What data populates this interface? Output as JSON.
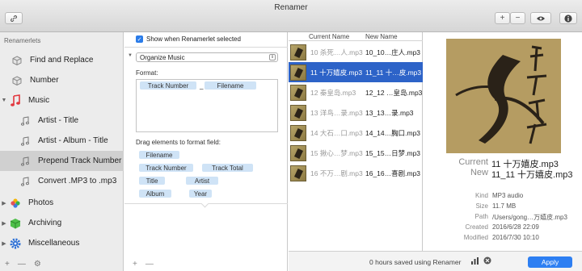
{
  "window": {
    "title": "Renamer"
  },
  "toolbar": {
    "plus": "+",
    "minus": "−"
  },
  "sidebar": {
    "header": "Renamerlets",
    "items": [
      {
        "label": "Find and Replace",
        "icon": "cube-icon"
      },
      {
        "label": "Number",
        "icon": "cube-icon"
      },
      {
        "label": "Music",
        "icon": "music-note-icon"
      },
      {
        "label": "Artist - Title",
        "icon": "music-note-icon"
      },
      {
        "label": "Artist - Album - Title",
        "icon": "music-note-icon"
      },
      {
        "label": "Prepend Track Number",
        "icon": "music-note-icon"
      },
      {
        "label": "Convert .MP3 to .mp3",
        "icon": "music-note-icon"
      },
      {
        "label": "Photos",
        "icon": "photos-icon"
      },
      {
        "label": "Archiving",
        "icon": "archive-icon"
      },
      {
        "label": "Miscellaneous",
        "icon": "gear-icon"
      }
    ],
    "footer": {
      "add": "+",
      "remove": "—",
      "gear": "⚙"
    }
  },
  "editor": {
    "show_when_selected": "Show when Renamerlet selected",
    "select_value": "Organize Music",
    "format_label": "Format:",
    "format_chips": [
      "Track Number",
      "_",
      "Filename"
    ],
    "drag_label": "Drag elements to format field:",
    "elements": [
      "Filename",
      "Track Number",
      "Track Total",
      "Title",
      "Artist",
      "Album",
      "Year"
    ],
    "footer": {
      "add": "+",
      "remove": "—"
    }
  },
  "file_list": {
    "columns": [
      "Current Name",
      "New Name"
    ],
    "rows": [
      {
        "current": "10 杀死…人.mp3",
        "new": "10_10…庄人.mp3"
      },
      {
        "current": "11 十万嬉皮.mp3",
        "new": "11_11 十…皮.mp3"
      },
      {
        "current": "12 秦皇岛.mp3",
        "new": "12_12 …皇岛.mp3"
      },
      {
        "current": "13 洋鸟…录.mp3",
        "new": "13_13…录.mp3"
      },
      {
        "current": "14 大石…口.mp3",
        "new": "14_14…胸口.mp3"
      },
      {
        "current": "15 揪心…梦.mp3",
        "new": "15_15…日梦.mp3"
      },
      {
        "current": "16 不万…剧.mp3",
        "new": "16_16…喜剧.mp3"
      }
    ]
  },
  "details": {
    "current_label": "Current",
    "current_value": "11 十万嬉皮.mp3",
    "new_label": "New",
    "new_value": "11_11 十万嬉皮.mp3",
    "fields": [
      {
        "label": "Kind",
        "value": "MP3 audio"
      },
      {
        "label": "Size",
        "value": "11.7 MB"
      },
      {
        "label": "Path",
        "value": "/Users/gong…万嬉皮.mp3"
      },
      {
        "label": "Created",
        "value": "2016/6/28 22:09"
      },
      {
        "label": "Modified",
        "value": "2016/7/30 10:10"
      }
    ]
  },
  "status": {
    "saved": "0 hours saved using Renamer",
    "apply": "Apply"
  }
}
